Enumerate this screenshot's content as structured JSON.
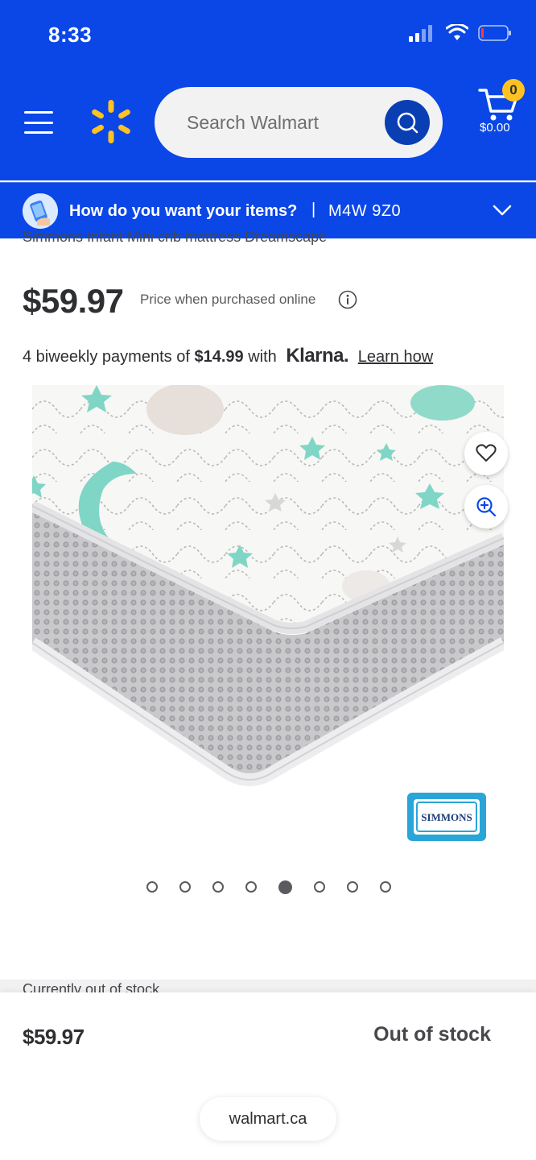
{
  "status_bar": {
    "time": "8:33"
  },
  "header": {
    "search": {
      "placeholder": "Search Walmart"
    },
    "cart": {
      "count": "0",
      "total": "$0.00"
    }
  },
  "location_bar": {
    "question": "How do you want your items?",
    "separator": "|",
    "postal_code": "M4W 9Z0"
  },
  "product": {
    "title_partial": "Simmons Infant Mini crib mattress Dreamscape",
    "price": "$59.97",
    "price_note": "Price when purchased online",
    "klarna": {
      "prefix": "4 biweekly payments of",
      "amount": "$14.99",
      "with": "with",
      "brand": "Klarna.",
      "link": "Learn how"
    },
    "image_logo_text": "SIMMONS",
    "image_count": 8,
    "active_image_index": 4,
    "status_partial": "Currently out of stock"
  },
  "bottom_bar": {
    "price": "$59.97",
    "status": "Out of stock",
    "url": "walmart.ca"
  },
  "colors": {
    "brand_blue": "#0a47e6",
    "spark_yellow": "#ffc220",
    "mint": "#7fd6c6"
  },
  "icons": [
    "signal-icon",
    "wifi-icon",
    "battery-icon",
    "menu-icon",
    "spark-logo-icon",
    "search-icon",
    "cart-icon",
    "delivery-icon",
    "chevron-down-icon",
    "info-icon",
    "heart-icon",
    "zoom-in-icon"
  ]
}
